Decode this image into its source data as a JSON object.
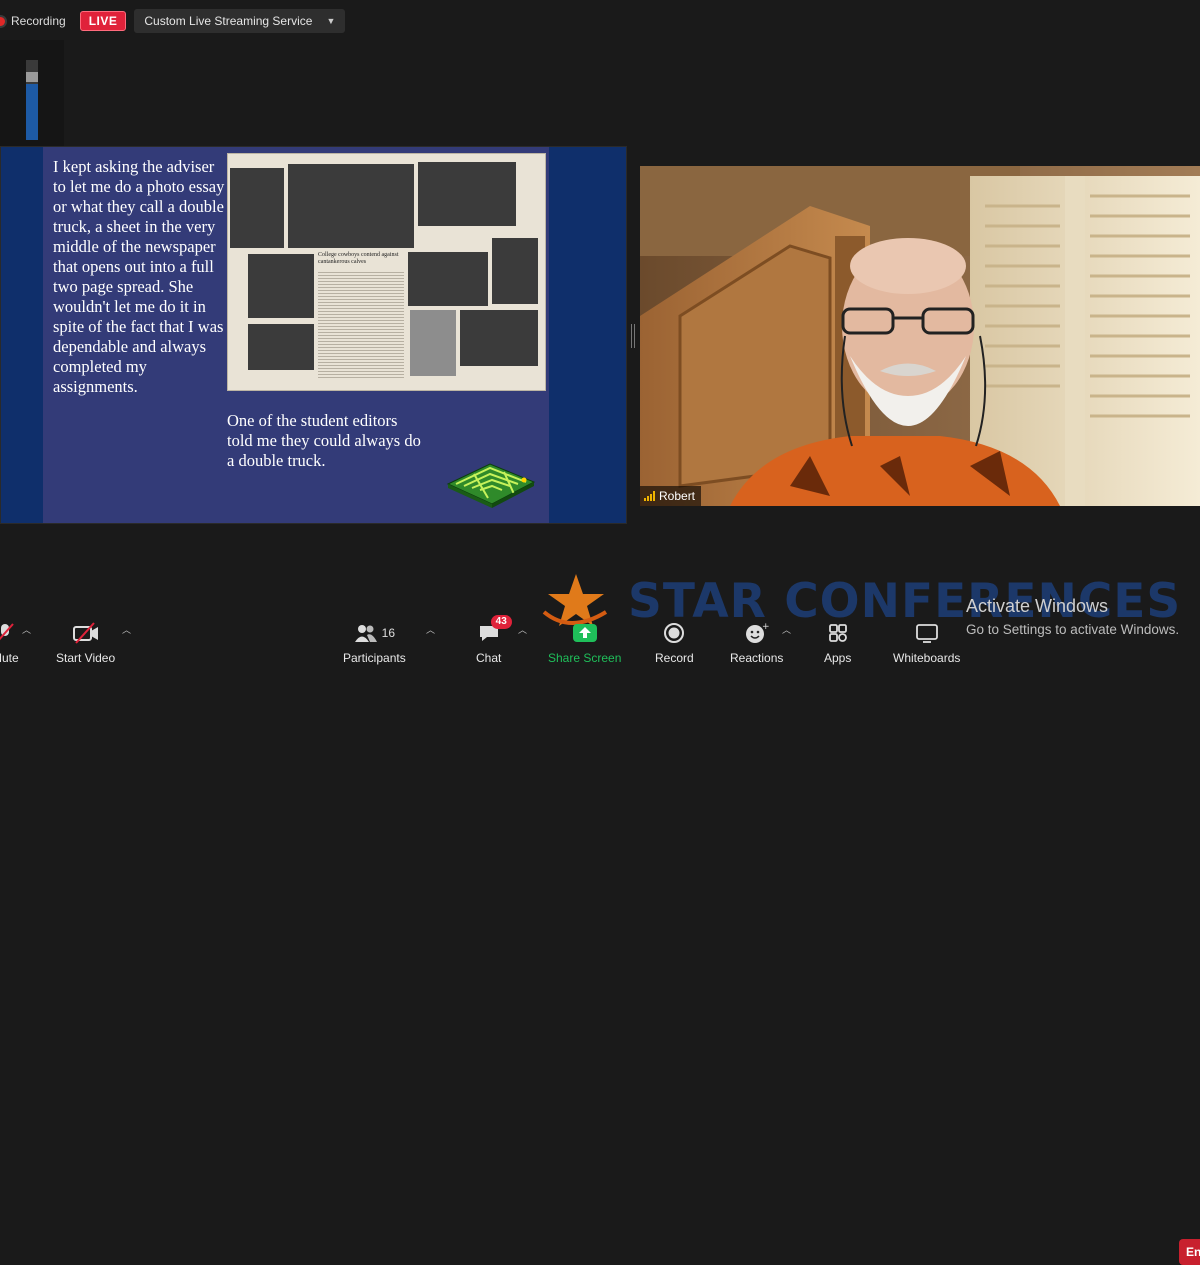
{
  "top_bar": {
    "recording_label": "Recording",
    "live_badge": "LIVE",
    "stream_service": "Custom Live Streaming Service"
  },
  "slide": {
    "body_text": "I kept asking the adviser to let me do a photo essay or what they call a double truck, a sheet in the very middle of the newspaper that opens out into a full two page spread. She wouldn't let me do it in spite of the fact that I was dependable and always completed my assignments.",
    "caption_text": "One of the student editors told me they could always do a double truck.",
    "newspaper_headline": "College cowboys contend against cantankerous calves"
  },
  "video": {
    "participant_name": "Robert"
  },
  "watermark": {
    "brand": "STAR CONFERENCES"
  },
  "windows_notice": {
    "title": "Activate Windows",
    "subtitle": "Go to Settings to activate Windows."
  },
  "toolbar": {
    "mute_label": "Mute",
    "start_video_label": "Start Video",
    "participants_label": "Participants",
    "participants_count": "16",
    "chat_label": "Chat",
    "chat_badge": "43",
    "share_screen_label": "Share Screen",
    "record_label": "Record",
    "reactions_label": "Reactions",
    "apps_label": "Apps",
    "whiteboards_label": "Whiteboards",
    "end_label": "End"
  },
  "colors": {
    "live_red": "#e0223a",
    "share_green": "#1fbf5a",
    "slide_blue": "#333b78",
    "brand_navy": "#1d3a6e"
  }
}
